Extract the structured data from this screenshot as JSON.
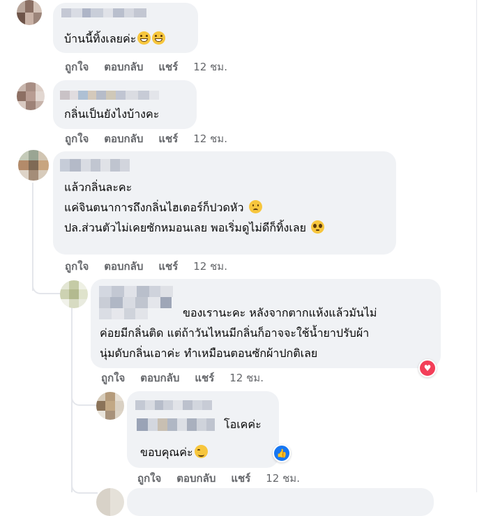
{
  "comments": [
    {
      "lines": [
        "บ้านนี้ทิ้งเลยค่ะ"
      ],
      "emoji": [
        "grinning-sweat-emoji",
        "grinning-sweat-emoji"
      ],
      "actions": {
        "like": "ถูกใจ",
        "reply": "ตอบกลับ",
        "share": "แชร์",
        "time": "12 ชม."
      }
    },
    {
      "lines": [
        "กลิ่นเป็นยังไงบ้างคะ"
      ],
      "actions": {
        "like": "ถูกใจ",
        "reply": "ตอบกลับ",
        "share": "แชร์",
        "time": "12 ชม."
      }
    },
    {
      "lines": [
        "แล้วกลิ่นละคะ",
        "แค่จินตนาการถึงกลิ่นไฮเตอร์ก็ปวดหัว",
        "ปล.ส่วนตัวไม่เคยซักหมอนเลย พอเริ่มดูไม่ดีก็ทิ้งเลย"
      ],
      "emoji": [
        "worried-emoji",
        "pleading-emoji"
      ],
      "actions": {
        "like": "ถูกใจ",
        "reply": "ตอบกลับ",
        "share": "แชร์",
        "time": "12 ชม."
      }
    },
    {
      "lines": [
        "ของเรานะคะ หลังจากตากแห้งแล้วมันไม่",
        "ค่อยมีกลิ่นติด แต่ถ้าวันไหนมีกลิ่นก็อาจจะใช้น้ำยาปรับผ้า",
        "นุ่มดับกลิ่นเอาค่ะ ทำเหมือนตอนซักผ้าปกติเลย"
      ],
      "reaction": "love",
      "actions": {
        "like": "ถูกใจ",
        "reply": "ตอบกลับ",
        "share": "แชร์",
        "time": "12 ชม."
      }
    },
    {
      "lines": [
        "โอเคค่ะ",
        "ขอบคุณค่ะ"
      ],
      "emoji": [
        "smiling-blush-emoji"
      ],
      "reaction": "like",
      "actions": {
        "like": "ถูกใจ",
        "reply": "ตอบกลับ",
        "share": "แชร์",
        "time": "12 ชม."
      }
    }
  ],
  "colors": {
    "bubble": "#f0f2f5",
    "text": "#050505",
    "meta": "#65676b",
    "love": "#f33e58",
    "like": "#1877f2"
  }
}
